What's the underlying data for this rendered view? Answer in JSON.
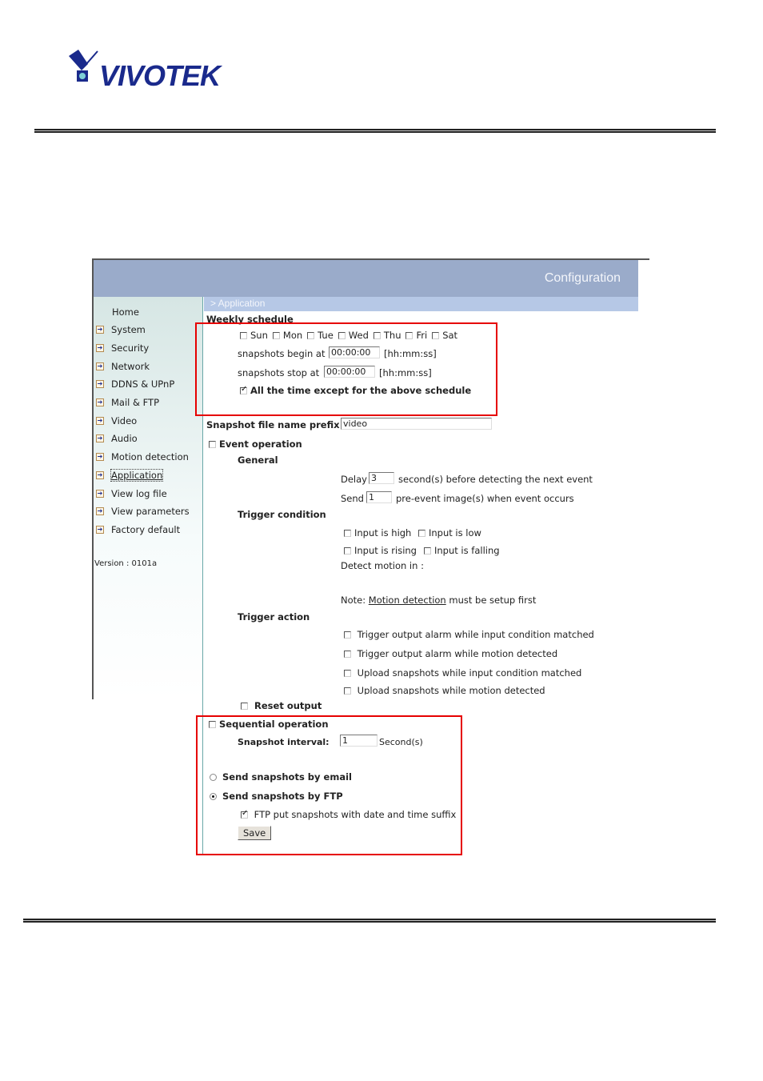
{
  "logo": {
    "text": "VIVOTEK",
    "brand_color": "#1a2a8c"
  },
  "header": {
    "title": "Configuration",
    "breadcrumb": "> Application"
  },
  "sidebar": {
    "items": [
      {
        "label": "Home",
        "icon": false
      },
      {
        "label": "System",
        "icon": "arrow-right-icon"
      },
      {
        "label": "Security",
        "icon": "arrow-right-icon"
      },
      {
        "label": "Network",
        "icon": "arrow-right-icon"
      },
      {
        "label": "DDNS & UPnP",
        "icon": "arrow-right-icon"
      },
      {
        "label": "Mail & FTP",
        "icon": "arrow-right-icon"
      },
      {
        "label": "Video",
        "icon": "arrow-right-icon"
      },
      {
        "label": "Audio",
        "icon": "arrow-right-icon"
      },
      {
        "label": "Motion detection",
        "icon": "arrow-right-icon"
      },
      {
        "label": "Application",
        "icon": "arrow-right-icon",
        "active": true
      },
      {
        "label": "View log file",
        "icon": "arrow-right-icon"
      },
      {
        "label": "View parameters",
        "icon": "arrow-right-icon"
      },
      {
        "label": "Factory default",
        "icon": "arrow-right-icon"
      }
    ],
    "version": "Version : 0101a"
  },
  "schedule": {
    "title": "Weekly schedule",
    "days": [
      {
        "label": "Sun",
        "checked": false
      },
      {
        "label": "Mon",
        "checked": false
      },
      {
        "label": "Tue",
        "checked": false
      },
      {
        "label": "Wed",
        "checked": false
      },
      {
        "label": "Thu",
        "checked": false
      },
      {
        "label": "Fri",
        "checked": false
      },
      {
        "label": "Sat",
        "checked": false
      }
    ],
    "begin_label": "snapshots begin at",
    "begin_value": "00:00:00",
    "stop_label": "snapshots stop at",
    "stop_value": "00:00:00",
    "time_format": "[hh:mm:ss]",
    "except_label": "All the time except for the above schedule",
    "except_checked": true
  },
  "prefix": {
    "label": "Snapshot file name prefix",
    "value": "video"
  },
  "event": {
    "label": "Event operation",
    "checked": false,
    "general_label": "General",
    "delay_label": "Delay",
    "delay_value": "3",
    "delay_suffix": "second(s) before detecting the next event",
    "send_label": "Send",
    "send_value": "1",
    "send_suffix": "pre-event image(s) when event occurs",
    "trigger_condition_label": "Trigger condition",
    "conditions": [
      {
        "label": "Input is high",
        "checked": false
      },
      {
        "label": "Input is low",
        "checked": false
      },
      {
        "label": "Input is rising",
        "checked": false
      },
      {
        "label": "Input is falling",
        "checked": false
      }
    ],
    "detect_motion_label": "Detect motion in :",
    "note_prefix": "Note:",
    "note_link": "Motion detection",
    "note_suffix": "must be setup first",
    "trigger_action_label": "Trigger action",
    "actions": [
      {
        "label": "Trigger output alarm while input condition matched",
        "checked": false
      },
      {
        "label": "Trigger output alarm while motion detected",
        "checked": false
      },
      {
        "label": "Upload snapshots while input condition matched",
        "checked": false
      },
      {
        "label": "Upload snapshots while motion detected",
        "checked": false
      }
    ],
    "reset_output_label": "Reset output",
    "reset_output_checked": false
  },
  "sequential": {
    "label": "Sequential operation",
    "checked": false,
    "interval_label": "Snapshot interval:",
    "interval_value": "1",
    "interval_unit": "Second(s)"
  },
  "delivery": {
    "email_label": "Send snapshots by email",
    "email_selected": false,
    "ftp_label": "Send snapshots by FTP",
    "ftp_selected": true,
    "suffix_label": "FTP put snapshots with date and time suffix",
    "suffix_checked": true
  },
  "save_label": "Save",
  "highlight_color": "#e60000"
}
